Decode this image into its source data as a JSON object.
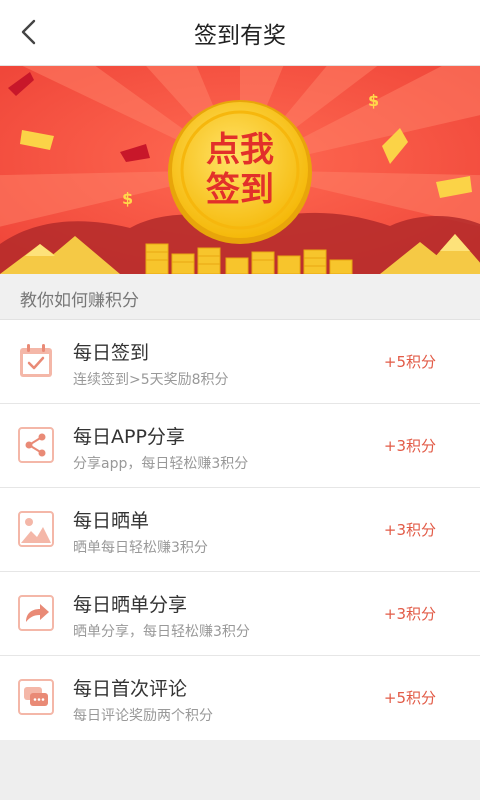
{
  "header": {
    "title": "签到有奖"
  },
  "banner": {
    "button_line1": "点我",
    "button_line2": "签到"
  },
  "section": {
    "title": "教你如何赚积分"
  },
  "items": [
    {
      "name": "每日签到",
      "desc": "连续签到>5天奖励8积分",
      "points": "+5积分",
      "icon": "calendar-check-icon"
    },
    {
      "name": "每日APP分享",
      "desc": "分享app，每日轻松赚3积分",
      "points": "+3积分",
      "icon": "share-icon"
    },
    {
      "name": "每日晒单",
      "desc": "晒单每日轻松赚3积分",
      "points": "+3积分",
      "icon": "image-icon"
    },
    {
      "name": "每日晒单分享",
      "desc": "晒单分享，每日轻松赚3积分",
      "points": "+3积分",
      "icon": "forward-arrow-icon"
    },
    {
      "name": "每日首次评论",
      "desc": "每日评论奖励两个积分",
      "points": "+5积分",
      "icon": "comment-bubble-icon"
    }
  ],
  "colors": {
    "accent": "#e25b47",
    "banner_red": "#f0473a",
    "coin_gold": "#f9c411"
  }
}
